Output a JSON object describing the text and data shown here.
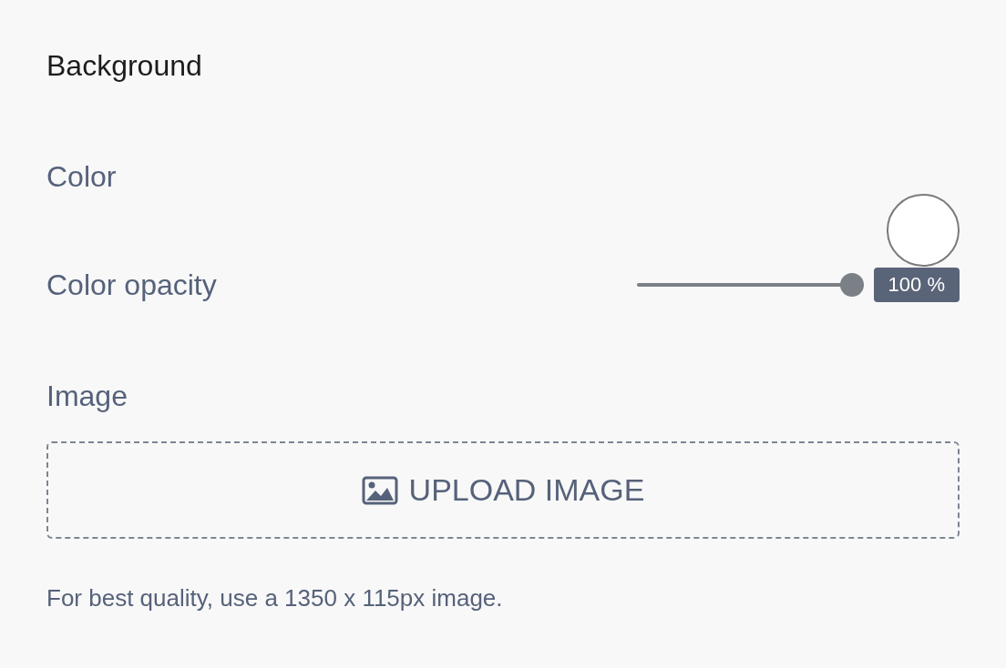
{
  "section_title": "Background",
  "color": {
    "label": "Color"
  },
  "opacity": {
    "label": "Color opacity",
    "level": 1,
    "reading": "100 %"
  },
  "image": {
    "label": "Image",
    "button": "UPLOAD IMAGE",
    "hint": "For best quality, use a 1350 x 115px image."
  }
}
